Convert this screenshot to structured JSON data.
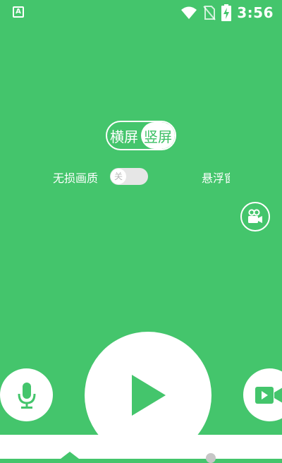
{
  "status_bar": {
    "time": "3:56",
    "left_badge": "A",
    "icons": [
      "wifi-icon",
      "no-sim-icon",
      "battery-charging-icon"
    ]
  },
  "orientation": {
    "options": [
      "横屏",
      "竖屏"
    ],
    "selected": "竖屏"
  },
  "settings": {
    "quality_label": "无损画质",
    "quality_toggle_state": "关",
    "float_label": "悬浮窗"
  },
  "controls": {
    "icons": [
      "microphone-icon",
      "play-icon",
      "video-camera-icon"
    ]
  },
  "colors": {
    "background": "#44c56c",
    "accent": "#3cbf64",
    "switch_off": "#e6e6e6",
    "nav_icon": "#c6c6c6"
  }
}
